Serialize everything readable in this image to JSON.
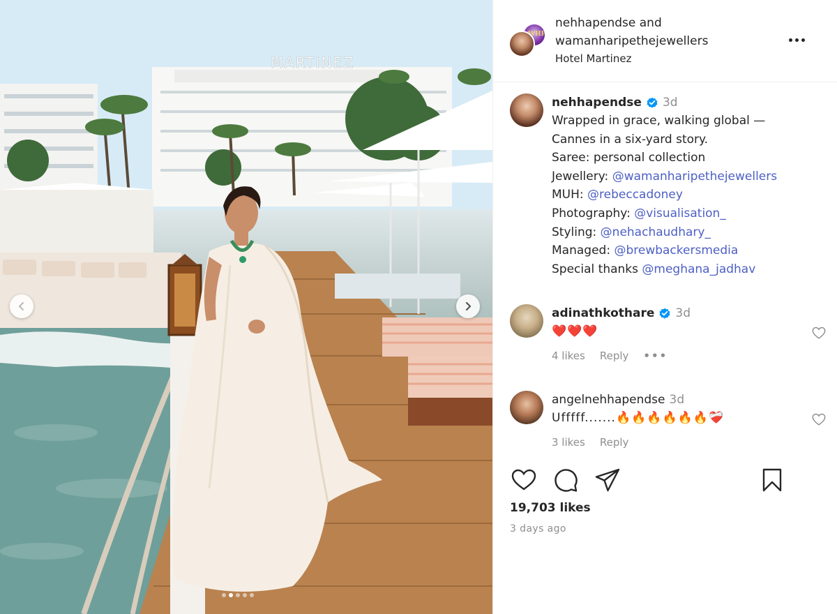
{
  "post": {
    "author": "nehhapendse",
    "and_text": "and",
    "collaborator": "wamanharipethejewellers",
    "location": "Hotel Martinez",
    "hotel_sign": "MARTINEZ",
    "collab_logo_text": "WHP"
  },
  "caption": {
    "username": "nehhapendse",
    "time": "3d",
    "lines": [
      {
        "text": "Wrapped in grace, walking global —",
        "mention": ""
      },
      {
        "text": "Cannes in a six-yard story.",
        "mention": ""
      },
      {
        "text": "Saree: personal collection",
        "mention": ""
      },
      {
        "text": "Jewellery: ",
        "mention": "@wamanharipethejewellers"
      },
      {
        "text": "MUH: ",
        "mention": "@rebeccadoney"
      },
      {
        "text": "Photography: ",
        "mention": "@visualisation_"
      },
      {
        "text": "Styling: ",
        "mention": "@nehachaudhary_"
      },
      {
        "text": "Managed: ",
        "mention": "@brewbackersmedia"
      },
      {
        "text": "Special thanks ",
        "mention": "@meghana_jadhav"
      }
    ]
  },
  "comments": [
    {
      "username": "adinathkothare",
      "time": "3d",
      "text": "❤️❤️❤️",
      "likes": "4 likes",
      "reply": "Reply",
      "verified": true
    },
    {
      "username": "angelnehhapendse",
      "time": "3d",
      "text": "Ufffff.......🔥🔥🔥🔥🔥🔥❤️‍🩹",
      "likes": "3 likes",
      "reply": "Reply",
      "verified": false
    }
  ],
  "stats": {
    "likes": "19,703 likes",
    "posted": "3 days ago"
  },
  "carousel": {
    "slide_count": 5,
    "active_slide": 2
  },
  "colors": {
    "mention": "#4d5fc4",
    "muted": "#8e8e8e",
    "verified": "#0095f6",
    "text": "#262626"
  },
  "icons": [
    "heart-icon",
    "comment-icon",
    "share-icon",
    "bookmark-icon",
    "more-icon",
    "chevron-left-icon",
    "chevron-right-icon"
  ]
}
